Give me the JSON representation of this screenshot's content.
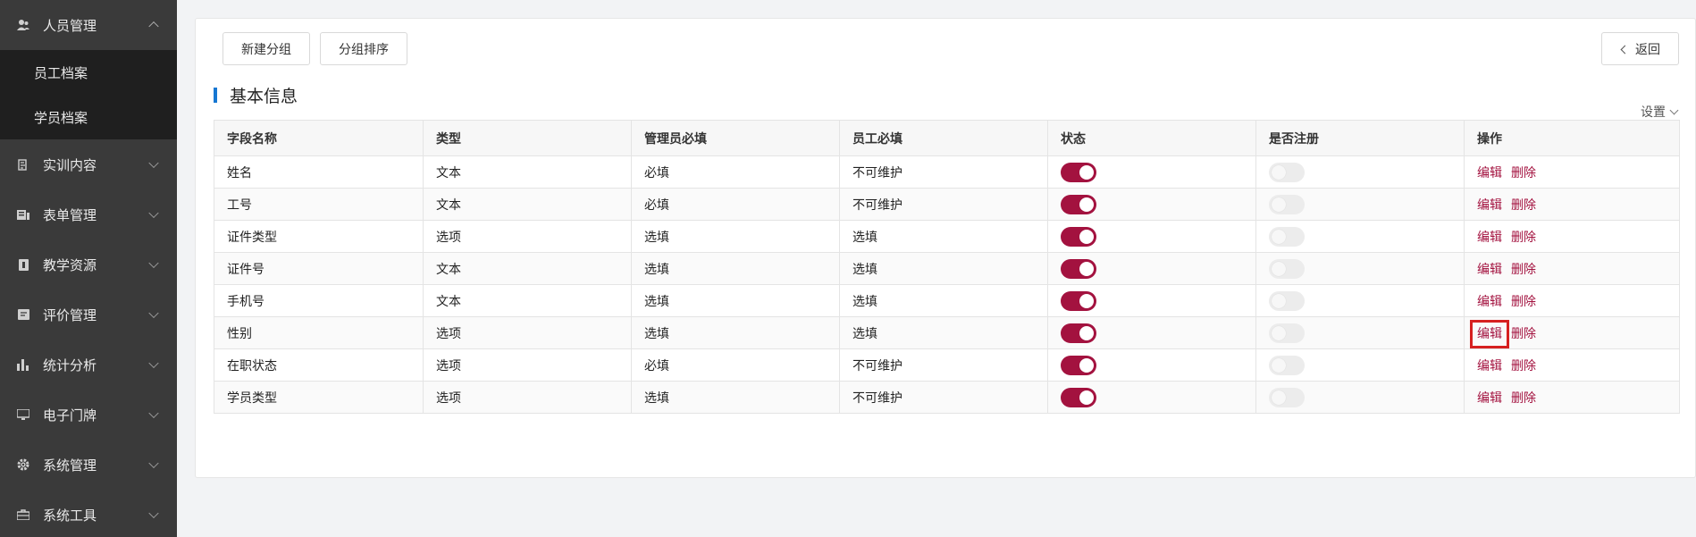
{
  "sidebar": {
    "items": [
      {
        "label": "人员管理",
        "icon": "person-icon",
        "open": true,
        "children": [
          {
            "label": "员工档案"
          },
          {
            "label": "学员档案"
          }
        ]
      },
      {
        "label": "实训内容",
        "icon": "document-icon"
      },
      {
        "label": "表单管理",
        "icon": "form-icon"
      },
      {
        "label": "教学资源",
        "icon": "book-icon"
      },
      {
        "label": "评价管理",
        "icon": "review-icon"
      },
      {
        "label": "统计分析",
        "icon": "bar-chart-icon"
      },
      {
        "label": "电子门牌",
        "icon": "monitor-icon"
      },
      {
        "label": "系统管理",
        "icon": "gear-icon"
      },
      {
        "label": "系统工具",
        "icon": "toolbox-icon"
      }
    ]
  },
  "toolbar": {
    "new_group": "新建分组",
    "sort_group": "分组排序",
    "back": "返回"
  },
  "section": {
    "title": "基本信息",
    "settings": "设置"
  },
  "table": {
    "columns": [
      "字段名称",
      "类型",
      "管理员必填",
      "员工必填",
      "状态",
      "是否注册",
      "操作"
    ],
    "rows": [
      {
        "name": "姓名",
        "type": "文本",
        "admin_required": "必填",
        "staff_required": "不可维护",
        "status": true,
        "registered": false
      },
      {
        "name": "工号",
        "type": "文本",
        "admin_required": "必填",
        "staff_required": "不可维护",
        "status": true,
        "registered": false
      },
      {
        "name": "证件类型",
        "type": "选项",
        "admin_required": "选填",
        "staff_required": "选填",
        "status": true,
        "registered": false
      },
      {
        "name": "证件号",
        "type": "文本",
        "admin_required": "选填",
        "staff_required": "选填",
        "status": true,
        "registered": false
      },
      {
        "name": "手机号",
        "type": "文本",
        "admin_required": "选填",
        "staff_required": "选填",
        "status": true,
        "registered": false
      },
      {
        "name": "性别",
        "type": "选项",
        "admin_required": "选填",
        "staff_required": "选填",
        "status": true,
        "registered": false
      },
      {
        "name": "在职状态",
        "type": "选项",
        "admin_required": "必填",
        "staff_required": "不可维护",
        "status": true,
        "registered": false
      },
      {
        "name": "学员类型",
        "type": "选项",
        "admin_required": "选填",
        "staff_required": "不可维护",
        "status": true,
        "registered": false
      }
    ],
    "actions": {
      "edit": "编辑",
      "delete": "删除"
    },
    "highlighted_row": 5
  },
  "colors": {
    "accent": "#a3123f",
    "title_bar": "#1677d2",
    "sidebar_bg": "#3a3a3a",
    "submenu_bg": "#1f1f1f"
  }
}
